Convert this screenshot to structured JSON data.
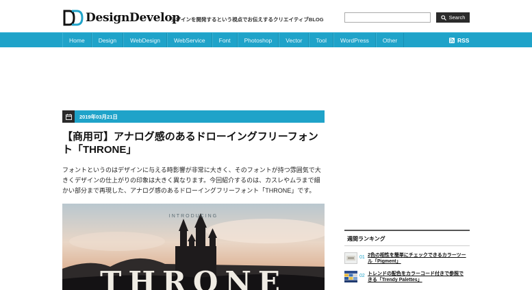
{
  "site": {
    "logo_text": "DesignDevelop",
    "tagline": "デザインを開発するという視点でお伝えするクリエイティブBLOG"
  },
  "search": {
    "placeholder": "",
    "button_label": "Search"
  },
  "nav": {
    "items": [
      "Home",
      "Design",
      "WebDesign",
      "WebService",
      "Font",
      "Photoshop",
      "Vector",
      "Tool",
      "WordPress",
      "Other"
    ],
    "rss_label": "RSS"
  },
  "article": {
    "date": "2019年03月21日",
    "title": "【商用可】アナログ感のあるドローイングフリーフォント「THRONE」",
    "body": "フォントというのはデザインに与える時影響が非常に大きく、そのフォントが持つ雰囲気で大きくデザインの仕上がりの印象は大きく異なります。今回紹介するのは、カスレやムラまで細かい部分まで再現した、アナログ感のあるドローイングフリーフォント「THRONE」です。",
    "hero": {
      "kicker": "INTRODUCING",
      "word": "THRONE"
    }
  },
  "sidebar": {
    "ranking_title": "週間ランキング",
    "items": [
      {
        "rank": "01",
        "text": "2色の相性を簡単にチェックできるカラーツール「Pigment」"
      },
      {
        "rank": "02",
        "text": "トレンドの配色をカラーコード付きで参照できる「Trendy Palettes」"
      }
    ]
  },
  "colors": {
    "accent": "#1fa3c9",
    "dark": "#2b2b2b"
  }
}
